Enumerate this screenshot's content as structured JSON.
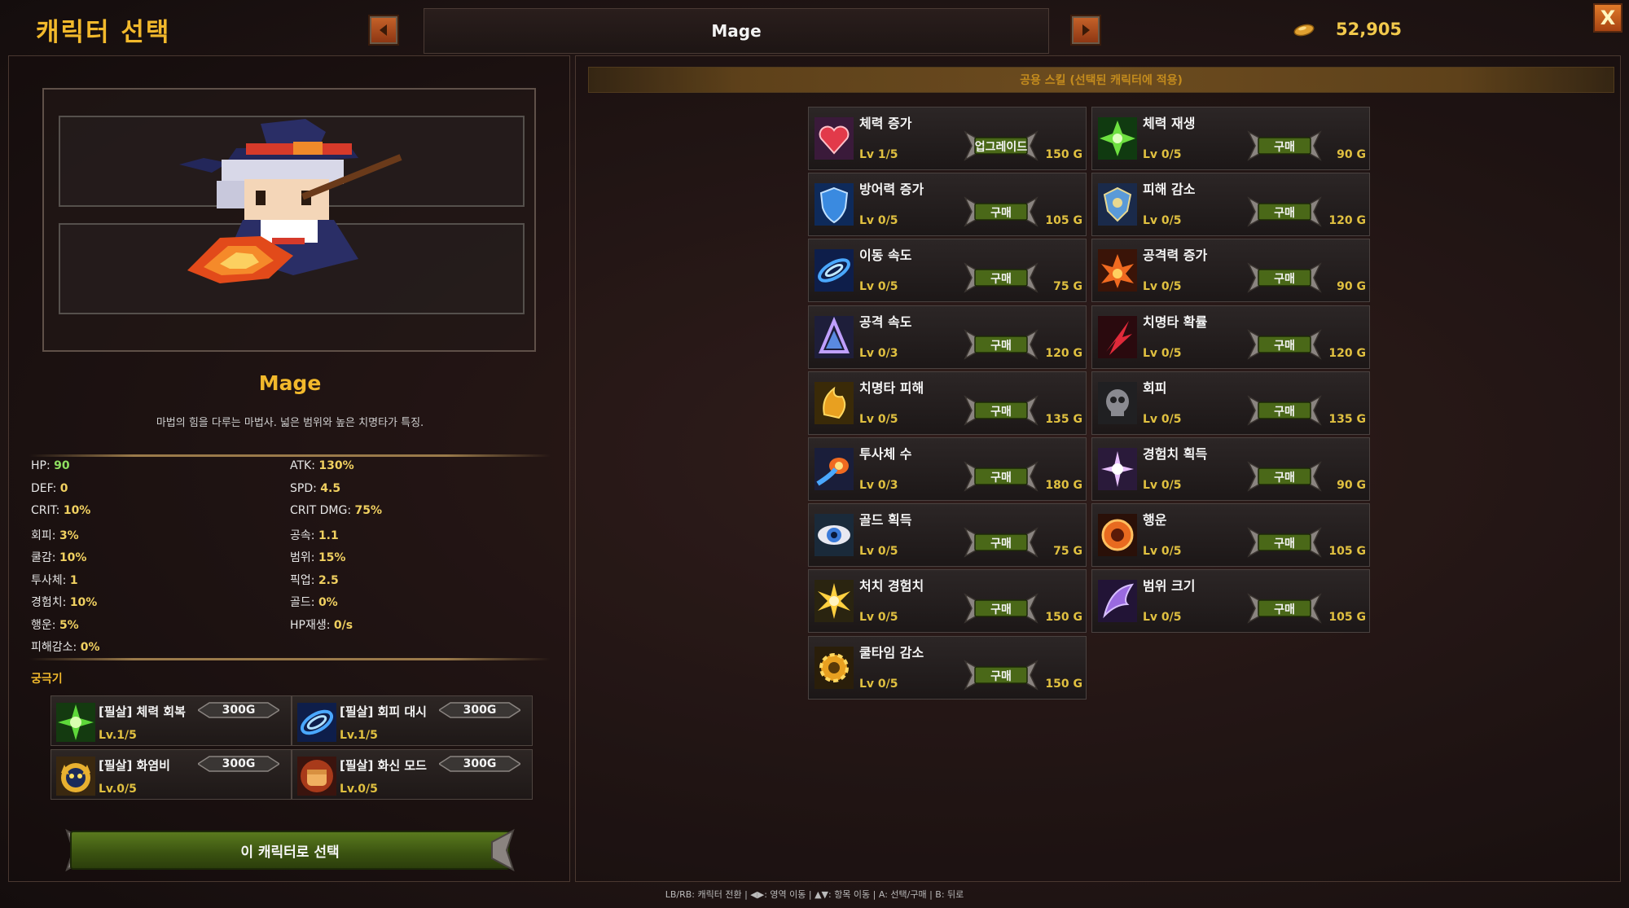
{
  "header": {
    "title": "캐릭터 선택",
    "class_name": "Mage",
    "gold": "52,905",
    "close_label": "X"
  },
  "character": {
    "name": "Mage",
    "description": "마법의 힘을 다루는 마법사. 넓은 범위와 높은 치명타가 특징."
  },
  "stats": [
    {
      "label": "HP:",
      "value": "90"
    },
    {
      "label": "ATK:",
      "value": "130%"
    },
    {
      "label": "DEF:",
      "value": "0"
    },
    {
      "label": "SPD:",
      "value": "4.5"
    },
    {
      "label": "CRIT:",
      "value": "10%"
    },
    {
      "label": "CRIT DMG:",
      "value": "75%"
    },
    {
      "label": "회피:",
      "value": "3%"
    },
    {
      "label": "공속:",
      "value": "1.1"
    },
    {
      "label": "쿨감:",
      "value": "10%"
    },
    {
      "label": "범위:",
      "value": "15%"
    },
    {
      "label": "투사체:",
      "value": "1"
    },
    {
      "label": "픽업:",
      "value": "2.5"
    },
    {
      "label": "경험치:",
      "value": "10%"
    },
    {
      "label": "골드:",
      "value": "0%"
    },
    {
      "label": "행운:",
      "value": "5%"
    },
    {
      "label": "HP재생:",
      "value": "0/s"
    },
    {
      "label": "피해감소:",
      "value": "0%"
    }
  ],
  "ultimates": {
    "heading": "궁극기",
    "items": [
      {
        "name": "[필살] 체력 회복",
        "level": "Lv.1/5",
        "price": "300G"
      },
      {
        "name": "[필살] 회피 대시",
        "level": "Lv.1/5",
        "price": "300G"
      },
      {
        "name": "[필살] 화염비",
        "level": "Lv.0/5",
        "price": "300G"
      },
      {
        "name": "[필살] 화신 모드",
        "level": "Lv.0/5",
        "price": "300G"
      }
    ]
  },
  "select_button": "이 캐릭터로 선택",
  "section_title": "공용 스킬 (선택된 캐릭터에 적용)",
  "skills": [
    {
      "name": "체력 증가",
      "level": "Lv 1/5",
      "action": "업그레이드",
      "cost": "150 G"
    },
    {
      "name": "체력 재생",
      "level": "Lv 0/5",
      "action": "구매",
      "cost": "90 G"
    },
    {
      "name": "방어력 증가",
      "level": "Lv 0/5",
      "action": "구매",
      "cost": "105 G"
    },
    {
      "name": "피해 감소",
      "level": "Lv 0/5",
      "action": "구매",
      "cost": "120 G"
    },
    {
      "name": "이동 속도",
      "level": "Lv 0/5",
      "action": "구매",
      "cost": "75 G"
    },
    {
      "name": "공격력 증가",
      "level": "Lv 0/5",
      "action": "구매",
      "cost": "90 G"
    },
    {
      "name": "공격 속도",
      "level": "Lv 0/3",
      "action": "구매",
      "cost": "120 G"
    },
    {
      "name": "치명타 확률",
      "level": "Lv 0/5",
      "action": "구매",
      "cost": "120 G"
    },
    {
      "name": "치명타 피해",
      "level": "Lv 0/5",
      "action": "구매",
      "cost": "135 G"
    },
    {
      "name": "회피",
      "level": "Lv 0/5",
      "action": "구매",
      "cost": "135 G"
    },
    {
      "name": "투사체 수",
      "level": "Lv 0/3",
      "action": "구매",
      "cost": "180 G"
    },
    {
      "name": "경험치 획득",
      "level": "Lv 0/5",
      "action": "구매",
      "cost": "90 G"
    },
    {
      "name": "골드 획득",
      "level": "Lv 0/5",
      "action": "구매",
      "cost": "75 G"
    },
    {
      "name": "행운",
      "level": "Lv 0/5",
      "action": "구매",
      "cost": "105 G"
    },
    {
      "name": "처치 경험치",
      "level": "Lv 0/5",
      "action": "구매",
      "cost": "150 G"
    },
    {
      "name": "범위 크기",
      "level": "Lv 0/5",
      "action": "구매",
      "cost": "105 G"
    },
    {
      "name": "쿨타임 감소",
      "level": "Lv 0/5",
      "action": "구매",
      "cost": "150 G"
    }
  ],
  "footer_hint": "LB/RB: 캐릭터 전환 | ◀▶: 영역 이동 | ▲▼: 항목 이동 | A: 선택/구매 | B: 뒤로",
  "colors": {
    "accent_gold": "#f2b92c",
    "level_yellow": "#e0c040",
    "button_green": "#4a6818",
    "hp_green": "#8fe060"
  }
}
